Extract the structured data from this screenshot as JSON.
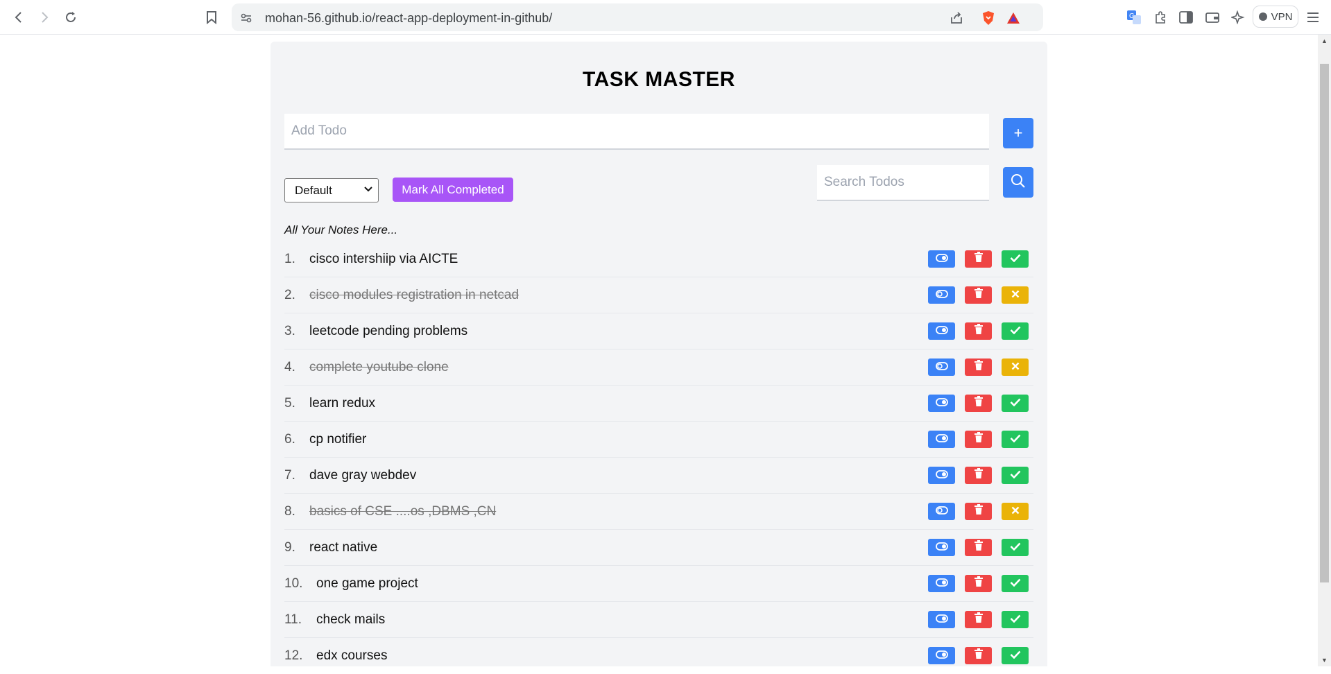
{
  "browser": {
    "url": "mohan-56.github.io/react-app-deployment-in-github/",
    "vpn_label": "VPN"
  },
  "app": {
    "title": "TASK MASTER",
    "add_placeholder": "Add Todo",
    "add_button_label": "+",
    "filter_selected": "Default",
    "mark_all_label": "Mark All Completed",
    "search_placeholder": "Search Todos",
    "notes_label": "All Your Notes Here...",
    "todos": [
      {
        "num": "1.",
        "text": "cisco intershiip via AICTE",
        "completed": false
      },
      {
        "num": "2.",
        "text": "cisco modules registration in netcad",
        "completed": true
      },
      {
        "num": "3.",
        "text": "leetcode pending problems",
        "completed": false
      },
      {
        "num": "4.",
        "text": "complete youtube clone",
        "completed": true
      },
      {
        "num": "5.",
        "text": "learn redux",
        "completed": false
      },
      {
        "num": "6.",
        "text": "cp notifier",
        "completed": false
      },
      {
        "num": "7.",
        "text": "dave gray webdev",
        "completed": false
      },
      {
        "num": "8.",
        "text": "basics of CSE ....os ,DBMS ,CN",
        "completed": true
      },
      {
        "num": "9.",
        "text": "react native",
        "completed": false
      },
      {
        "num": "10.",
        "text": "one game project",
        "completed": false
      },
      {
        "num": "11.",
        "text": "check mails",
        "completed": false
      },
      {
        "num": "12.",
        "text": "edx courses",
        "completed": false
      }
    ]
  },
  "colors": {
    "primary": "#3b82f6",
    "danger": "#ef4444",
    "success": "#22c55e",
    "warning": "#eab308",
    "purple": "#a855f7"
  }
}
